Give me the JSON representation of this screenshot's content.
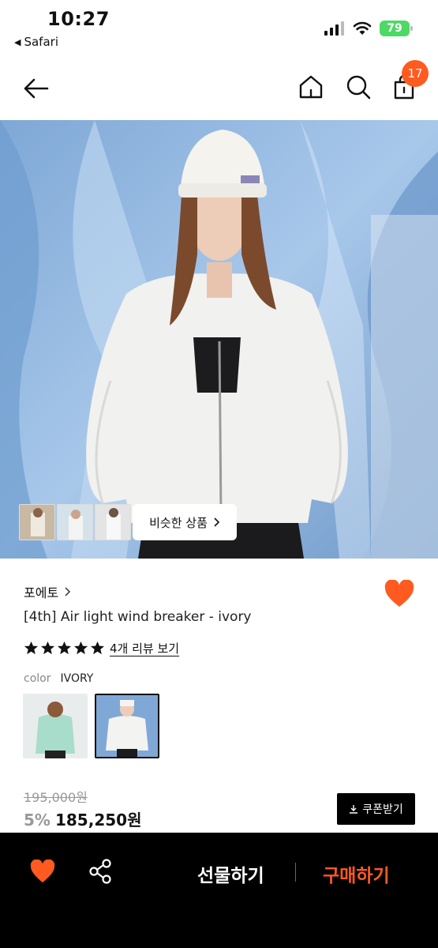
{
  "status_bar": {
    "time": "10:27",
    "back_app": "Safari",
    "battery": "79"
  },
  "nav": {
    "cart_count": "17"
  },
  "gallery": {
    "similar_label": "비슷한 상품"
  },
  "product": {
    "brand": "포에토",
    "name": "[4th] Air light wind breaker - ivory",
    "rating": 5,
    "review_link": "4개 리뷰 보기",
    "color_label": "color",
    "color_value": "IVORY"
  },
  "price": {
    "original": "195,000원",
    "discount": "5%",
    "final": "185,250원",
    "coupon_label": "쿠폰받기"
  },
  "bottom_bar": {
    "gift_label": "선물하기",
    "buy_label": "구매하기"
  },
  "colors": {
    "accent": "#ff5a1f",
    "battery": "#4cd964"
  }
}
